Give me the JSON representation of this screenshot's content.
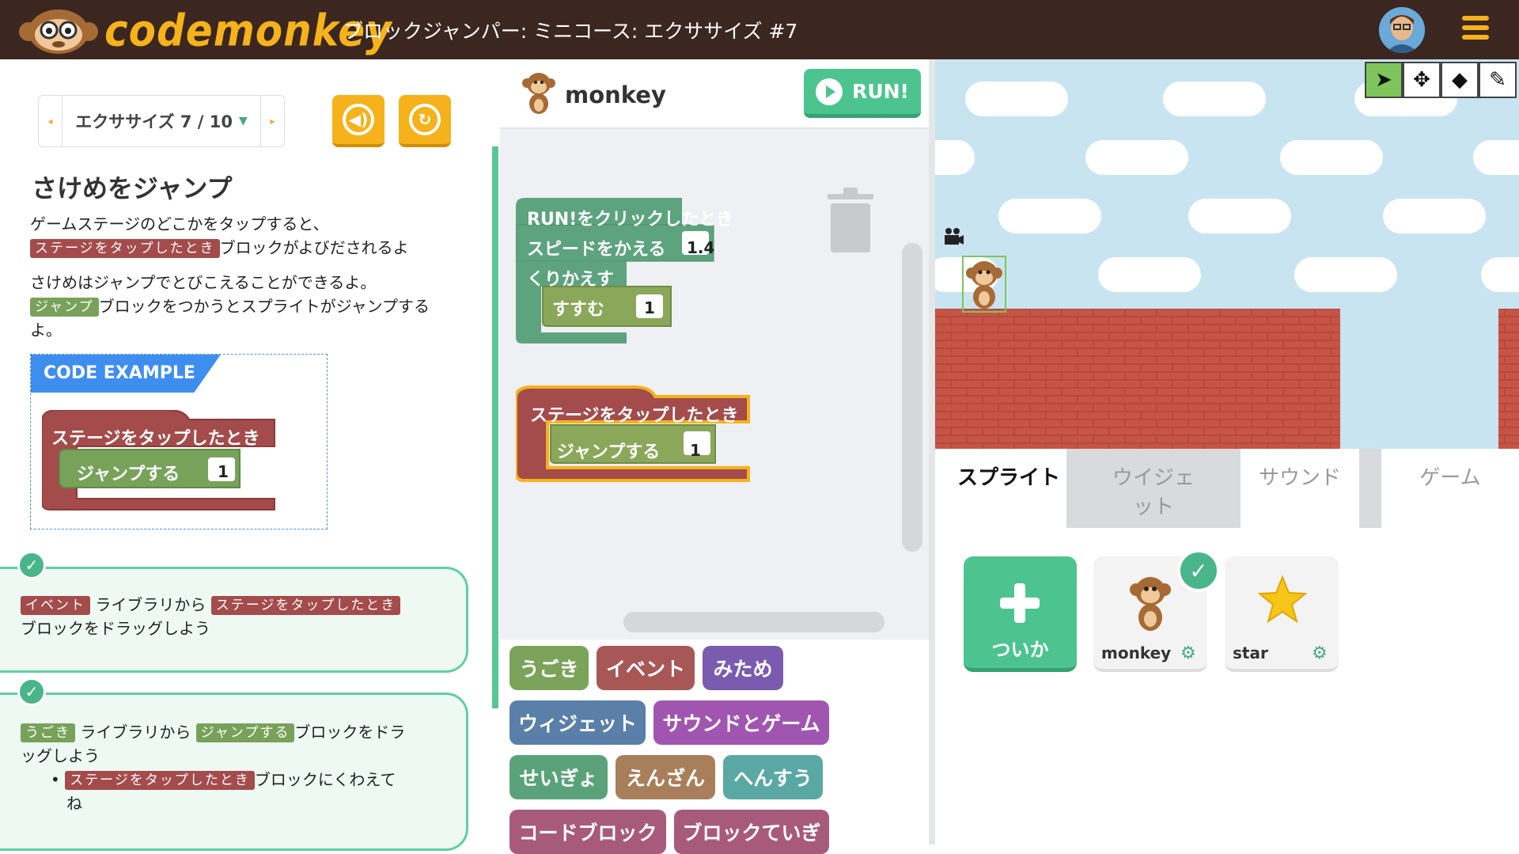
{
  "header": {
    "logo_text": "codemonkey",
    "title": "ブロックジャンパー: ミニコース: エクササイズ #7"
  },
  "exercise_nav": {
    "label": "エクササイズ 7 / 10"
  },
  "instructions": {
    "heading": "さけめをジャンプ",
    "p1_a": "ゲームステージのどこかをタップすると、",
    "p1_tag": "ステージをタップしたとき",
    "p1_b": "ブロックがよびだされるよ",
    "p2_a": "さけめはジャンプでとびこえることができるよ。",
    "p2_tag": "ジャンプ",
    "p2_b": "ブロックをつかうとスプライトがジャンプする",
    "p2_c": "よ。",
    "code_example_label": "CODE EXAMPLE",
    "example_hat": "ステージをタップしたとき",
    "example_stmt": "ジャンプする",
    "example_val": "1"
  },
  "steps": [
    {
      "tag1": "イベント",
      "t1": "ライブラリから",
      "tag2": "ステージをタップしたとき",
      "t2": "ブロックをドラッグしよう"
    },
    {
      "tag1": "うごき",
      "t1": "ライブラリから",
      "tag2": "ジャンプする",
      "t2": "ブロックをドラ",
      "t3": "ッグしよう",
      "bullet_tag": "ステージをタップしたとき",
      "bullet_text": "ブロックにくわえて",
      "bullet_text2": "ね"
    }
  ],
  "workspace": {
    "sprite_name": "monkey",
    "run_label": "RUN!",
    "blocks": {
      "run_hat": "RUN!をクリックしたとき",
      "set_speed": "スピードをかえる",
      "speed_val": "1.4",
      "repeat": "くりかえす",
      "step": "すすむ",
      "step_val": "1",
      "tap_hat": "ステージをタップしたとき",
      "jump": "ジャンプする",
      "jump_val": "1"
    },
    "categories": [
      {
        "label": "うごき",
        "color": "#7ba35a"
      },
      {
        "label": "イベント",
        "color": "#a85757"
      },
      {
        "label": "みため",
        "color": "#7b5bb0"
      },
      {
        "label": "ウィジェット",
        "color": "#5a7fa8"
      },
      {
        "label": "サウンドとゲーム",
        "color": "#a056b0"
      },
      {
        "label": "せいぎょ",
        "color": "#5aa37a"
      },
      {
        "label": "えんざん",
        "color": "#a87f5a"
      },
      {
        "label": "へんすう",
        "color": "#5aa8a3"
      },
      {
        "label": "コードブロック",
        "color": "#a85a7c"
      },
      {
        "label": "ブロックていぎ",
        "color": "#a85a7c"
      }
    ]
  },
  "stage_tools": [
    "cursor-icon",
    "move-icon",
    "eraser-icon",
    "pen-icon"
  ],
  "tabs": [
    "スプライト",
    "ウイジェット",
    "サウンド",
    "ゲーム"
  ],
  "sprites": {
    "add_label": "ついか",
    "items": [
      {
        "name": "monkey"
      },
      {
        "name": "star"
      }
    ]
  }
}
